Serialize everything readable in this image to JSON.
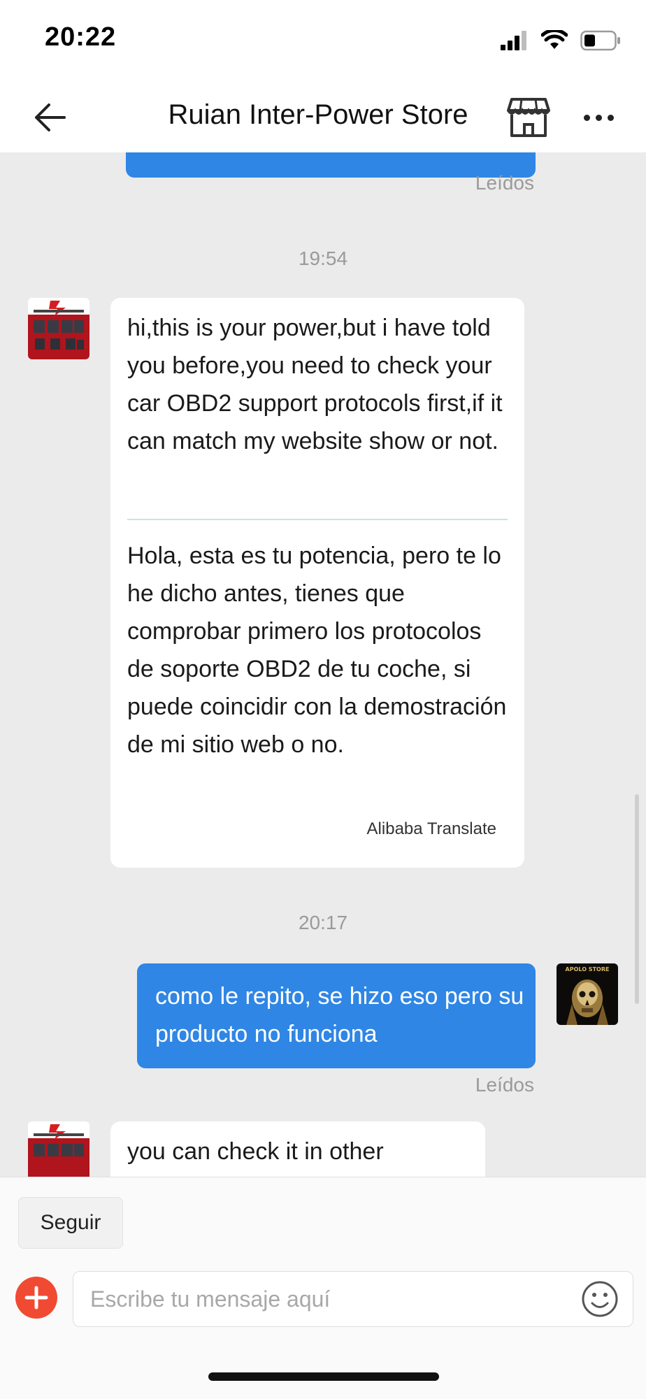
{
  "status_bar": {
    "time": "20:22",
    "icons": [
      "signal-icon",
      "wifi-icon",
      "battery-icon"
    ],
    "battery_level": 0.35
  },
  "nav": {
    "back_icon": "arrow-left-icon",
    "title": "Ruian Inter-Power Store",
    "store_icon": "storefront-icon",
    "more_icon": "more-dots-icon"
  },
  "chat": {
    "messages": [
      {
        "type": "outgoing-cut",
        "read_label": "Leídos"
      },
      {
        "type": "timestamp",
        "text": "19:54"
      },
      {
        "type": "incoming",
        "text": "hi,this is your power,but i have told you before,you need to check your car OBD2 support protocols first,if it can match my website show or not.",
        "translation": "Hola, esta es tu potencia, pero te lo he dicho antes, tienes que comprobar primero los protocolos de soporte OBD2 de tu coche, si puede coincidir con la demostración de mi sitio web o no.",
        "translation_source": "Alibaba Translate"
      },
      {
        "type": "timestamp",
        "text": "20:17"
      },
      {
        "type": "outgoing",
        "text": "como le repito, se hizo eso pero su producto no funciona",
        "read_label": "Leídos",
        "avatar_text": "APOLO STORE"
      },
      {
        "type": "incoming",
        "text": "you can check it in other"
      }
    ]
  },
  "bottom": {
    "follow_label": "Seguir",
    "add_icon": "plus-circle-icon",
    "input_placeholder": "Escribe tu mensaje aquí",
    "emoji_icon": "smiley-icon"
  },
  "colors": {
    "accent_blue": "#2f86e5",
    "chat_background": "#ebebeb",
    "add_button_red": "#f04a33",
    "meta_gray": "#9a9a9a"
  }
}
